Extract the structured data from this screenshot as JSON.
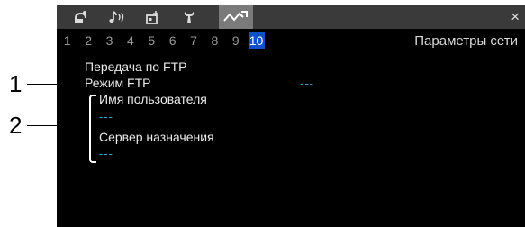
{
  "callouts": {
    "one": "1",
    "two": "2"
  },
  "tabs": [
    {
      "name": "camera-icon"
    },
    {
      "name": "audio-icon"
    },
    {
      "name": "recording-icon"
    },
    {
      "name": "wrench-icon"
    },
    {
      "name": "network-icon",
      "active": true
    }
  ],
  "close_label": "×",
  "pages": [
    "1",
    "2",
    "3",
    "4",
    "5",
    "6",
    "7",
    "8",
    "9",
    "10"
  ],
  "active_page": "10",
  "page_title": "Параметры сети",
  "menu": {
    "section": "Передача по FTP",
    "ftp_mode_label": "Режим FTP",
    "ftp_mode_value": "---",
    "username_label": "Имя пользователя",
    "username_value": "---",
    "server_label": "Сервер назначения",
    "server_value": "---"
  },
  "colors": {
    "accent": "#0c53c9",
    "value": "#2aa6d8",
    "active_tab": "#7a7a7a"
  }
}
